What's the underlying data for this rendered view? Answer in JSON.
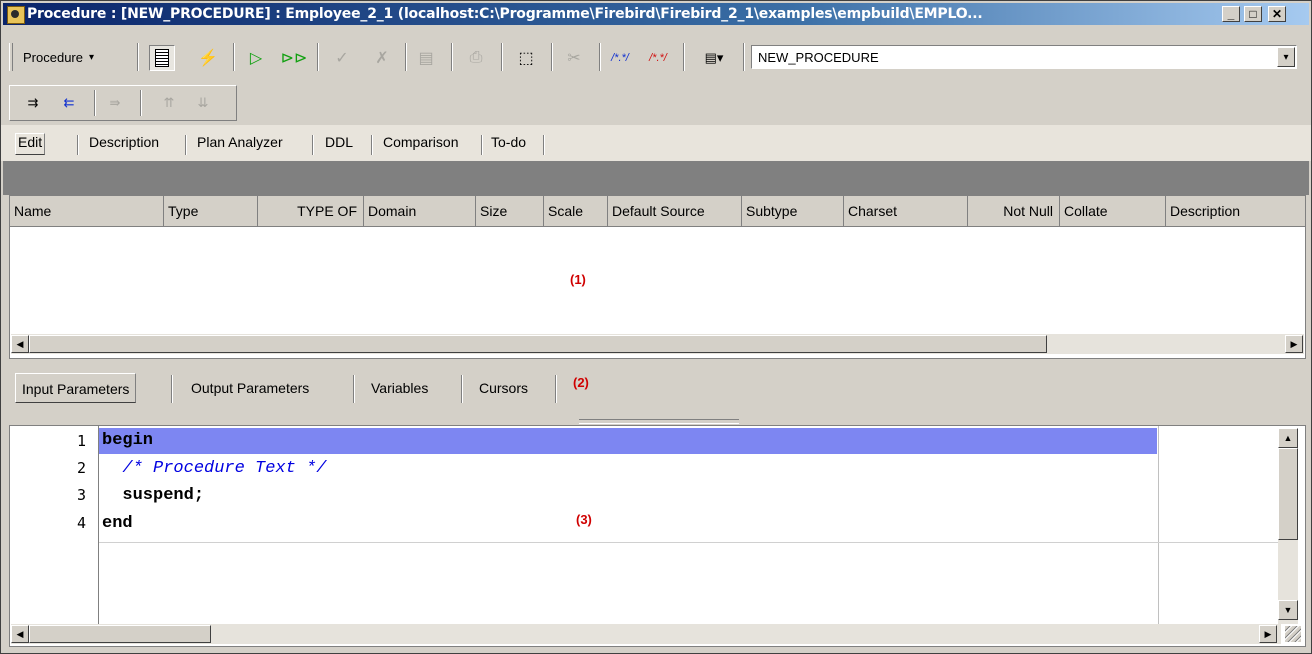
{
  "window": {
    "title": "Procedure : [NEW_PROCEDURE] : Employee_2_1 (localhost:C:\\Programme\\Firebird\\Firebird_2_1\\examples\\empbuild\\EMPLO...",
    "minimize_glyph": "_",
    "maximize_glyph": "□",
    "close_glyph": "✕"
  },
  "toolbar": {
    "procedure_menu": "Procedure",
    "procedure_menu_arrow": "▾",
    "object_selector": {
      "value": "NEW_PROCEDURE",
      "arrow": "▾"
    }
  },
  "editor_tabs": [
    "Edit",
    "Description",
    "Plan Analyzer",
    "DDL",
    "Comparison",
    "To-do"
  ],
  "grid": {
    "columns": [
      "Name",
      "Type",
      "TYPE OF",
      "Domain",
      "Size",
      "Scale",
      "Default Source",
      "Subtype",
      "Charset",
      "Not Null",
      "Collate",
      "Description"
    ],
    "marker": "(1)"
  },
  "param_tabs": {
    "items": [
      "Input Parameters",
      "Output Parameters",
      "Variables",
      "Cursors"
    ],
    "marker": "(2)"
  },
  "code": {
    "line_numbers": [
      "1",
      "2",
      "3",
      "4"
    ],
    "lines": [
      "begin",
      "  /* Procedure Text */",
      "  suspend;",
      "end"
    ],
    "marker": "(3)"
  },
  "scroll_glyphs": {
    "left": "◀",
    "right": "▶",
    "up": "▲",
    "down": "▼"
  },
  "colors": {
    "title_start": "#0a246a",
    "highlight": "#7d86f2",
    "marker": "#d00000",
    "comment": "#0000e0"
  }
}
